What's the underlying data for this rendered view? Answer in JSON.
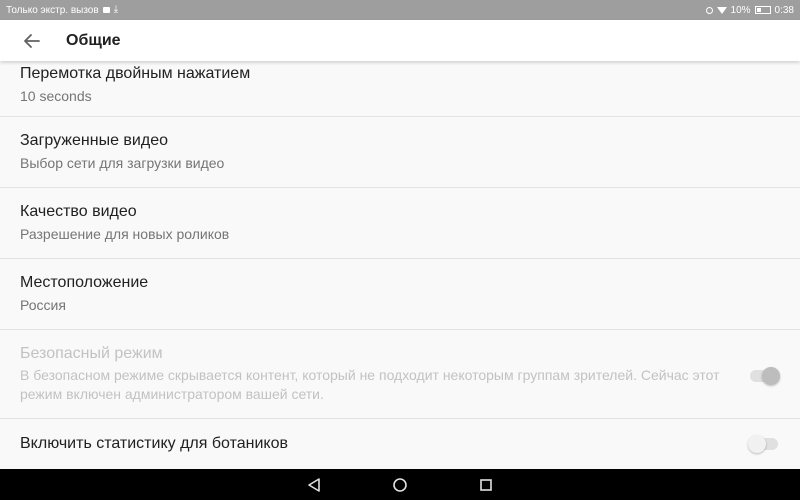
{
  "status_bar": {
    "left_text": "Только экстр. вызов",
    "battery": "10%",
    "time": "0:38"
  },
  "app_bar": {
    "title": "Общие"
  },
  "settings": [
    {
      "title": "Перемотка двойным нажатием",
      "summary": "10 seconds"
    },
    {
      "title": "Загруженные видео",
      "summary": "Выбор сети для загрузки видео"
    },
    {
      "title": "Качество видео",
      "summary": "Разрешение для новых роликов"
    },
    {
      "title": "Местоположение",
      "summary": "Россия"
    },
    {
      "title": "Безопасный режим",
      "summary": "В безопасном режиме скрывается контент, который не подходит некоторым группам зрителей. Сейчас этот режим включен администратором вашей сети.",
      "enabled": false,
      "switch_on": true
    },
    {
      "title": "Включить статистику для ботаников",
      "switch_on": false
    }
  ],
  "colors": {
    "status_bar": "#9e9e9e",
    "app_bar": "#ffffff",
    "background": "#f9f9f9",
    "nav_bar": "#000000"
  },
  "icons": {
    "back": "arrow-left-icon",
    "nav_back": "triangle-back-icon",
    "nav_home": "circle-home-icon",
    "nav_recents": "square-recents-icon"
  }
}
